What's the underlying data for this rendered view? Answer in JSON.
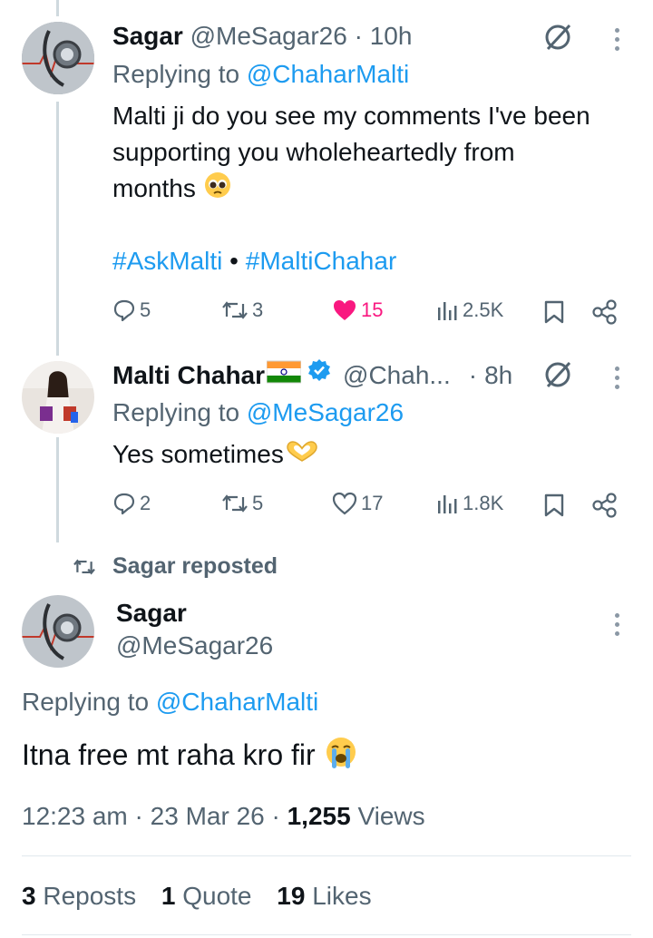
{
  "tweet1": {
    "name": "Sagar",
    "handle": "@MeSagar26",
    "sep": "·",
    "time": "10h",
    "replying_label": "Replying to",
    "replying_to": "@ChaharMalti",
    "text": "Malti ji do you see my comments I've been supporting you wholeheartedly from months",
    "hashtag1": "#AskMalti",
    "hashtag_sep": "•",
    "hashtag2": "#MaltiChahar",
    "replies": "5",
    "reposts": "3",
    "likes": "15",
    "views": "2.5K",
    "liked_color": "#f91880"
  },
  "tweet2": {
    "name": "Malti Chahar",
    "handle": "@Chah...",
    "sep": "·",
    "time": "8h",
    "replying_label": "Replying to",
    "replying_to": "@MeSagar26",
    "text": "Yes sometimes",
    "replies": "2",
    "reposts": "5",
    "likes": "17",
    "views": "1.8K",
    "verified_color": "#1d9bf0"
  },
  "repost_banner": {
    "text": "Sagar reposted"
  },
  "main_tweet": {
    "name": "Sagar",
    "handle": "@MeSagar26",
    "replying_label": "Replying to",
    "replying_to": "@ChaharMalti",
    "text": "Itna free mt raha kro fir",
    "time": "12:23 am",
    "sep1": "·",
    "date": "23 Mar 26",
    "sep2": "·",
    "views_count": "1,255",
    "views_label": "Views"
  },
  "stats": {
    "reposts_count": "3",
    "reposts_label": "Reposts",
    "quotes_count": "1",
    "quotes_label": "Quote",
    "likes_count": "19",
    "likes_label": "Likes"
  },
  "icons": {
    "reply": "reply-bubble-icon",
    "repost": "repost-arrows-icon",
    "like": "heart-icon",
    "views": "views-bar-chart-icon",
    "bookmark": "bookmark-icon",
    "share": "share-icon",
    "grok": "grok-slash-icon",
    "more": "more-dots-icon"
  },
  "colors": {
    "accent": "#1d9bf0",
    "muted": "#536471",
    "like": "#f91880"
  }
}
